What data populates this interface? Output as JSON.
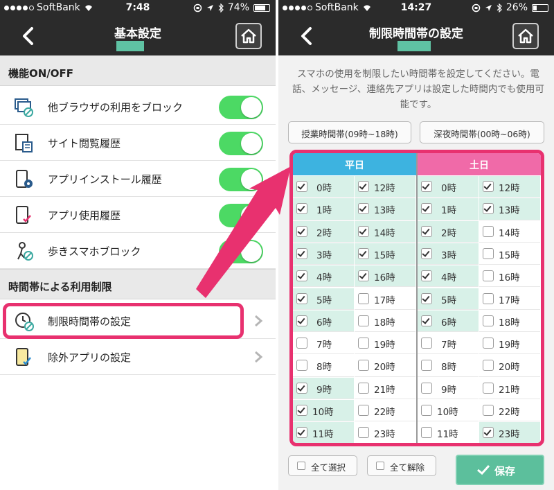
{
  "left": {
    "status": {
      "carrier": "SoftBank",
      "time": "7:48",
      "battery": "74%",
      "battery_level": 0.74
    },
    "nav": {
      "title": "基本設定",
      "back_icon": "chevron-left-icon",
      "home_icon": "home-icon"
    },
    "section1": {
      "title": "機能ON/OFF"
    },
    "rows": [
      {
        "label": "他ブラウザの利用をブロック",
        "icon": "browser-block-icon",
        "on": true
      },
      {
        "label": "サイト閲覧履歴",
        "icon": "site-history-icon",
        "on": true
      },
      {
        "label": "アプリインストール履歴",
        "icon": "app-install-icon",
        "on": true
      },
      {
        "label": "アプリ使用履歴",
        "icon": "app-usage-icon",
        "on": true
      },
      {
        "label": "歩きスマホブロック",
        "icon": "walking-block-icon",
        "on": true
      }
    ],
    "section2": {
      "title": "時間帯による利用制限"
    },
    "links": [
      {
        "label": "制限時間帯の設定",
        "icon": "clock-block-icon"
      },
      {
        "label": "除外アプリの設定",
        "icon": "exclude-app-icon"
      }
    ],
    "colors": {
      "toggle_on": "#4cd964",
      "highlight": "#e8316f",
      "accent_green": "#5fc2a3"
    }
  },
  "right": {
    "status": {
      "carrier": "SoftBank",
      "time": "14:27",
      "battery": "26%",
      "battery_level": 0.26
    },
    "nav": {
      "title": "制限時間帯の設定",
      "back_icon": "chevron-left-icon",
      "home_icon": "home-icon"
    },
    "description": "スマホの使用を制限したい時間帯を設定してください。電話、メッセージ、連絡先アプリは設定した時間内でも使用可能です。",
    "presets": [
      "授業時間帯(09時~18時)",
      "深夜時間帯(00時~06時)"
    ],
    "weekday": {
      "header": "平日",
      "color": "#3db3e0",
      "hours": [
        {
          "label": "0時",
          "checked": true
        },
        {
          "label": "1時",
          "checked": true
        },
        {
          "label": "2時",
          "checked": true
        },
        {
          "label": "3時",
          "checked": true
        },
        {
          "label": "4時",
          "checked": true
        },
        {
          "label": "5時",
          "checked": true
        },
        {
          "label": "6時",
          "checked": true
        },
        {
          "label": "7時",
          "checked": false
        },
        {
          "label": "8時",
          "checked": false
        },
        {
          "label": "9時",
          "checked": true
        },
        {
          "label": "10時",
          "checked": true
        },
        {
          "label": "11時",
          "checked": true
        },
        {
          "label": "12時",
          "checked": true
        },
        {
          "label": "13時",
          "checked": true
        },
        {
          "label": "14時",
          "checked": true
        },
        {
          "label": "15時",
          "checked": true
        },
        {
          "label": "16時",
          "checked": true
        },
        {
          "label": "17時",
          "checked": false
        },
        {
          "label": "18時",
          "checked": false
        },
        {
          "label": "19時",
          "checked": false
        },
        {
          "label": "20時",
          "checked": false
        },
        {
          "label": "21時",
          "checked": false
        },
        {
          "label": "22時",
          "checked": false
        },
        {
          "label": "23時",
          "checked": false
        }
      ]
    },
    "weekend": {
      "header": "土日",
      "color": "#f06aa8",
      "hours": [
        {
          "label": "0時",
          "checked": true
        },
        {
          "label": "1時",
          "checked": true
        },
        {
          "label": "2時",
          "checked": true
        },
        {
          "label": "3時",
          "checked": true
        },
        {
          "label": "4時",
          "checked": true
        },
        {
          "label": "5時",
          "checked": true
        },
        {
          "label": "6時",
          "checked": true
        },
        {
          "label": "7時",
          "checked": false
        },
        {
          "label": "8時",
          "checked": false
        },
        {
          "label": "9時",
          "checked": false
        },
        {
          "label": "10時",
          "checked": false
        },
        {
          "label": "11時",
          "checked": false
        },
        {
          "label": "12時",
          "checked": true
        },
        {
          "label": "13時",
          "checked": true
        },
        {
          "label": "14時",
          "checked": false
        },
        {
          "label": "15時",
          "checked": false
        },
        {
          "label": "16時",
          "checked": false
        },
        {
          "label": "17時",
          "checked": false
        },
        {
          "label": "18時",
          "checked": false
        },
        {
          "label": "19時",
          "checked": false
        },
        {
          "label": "20時",
          "checked": false
        },
        {
          "label": "21時",
          "checked": false
        },
        {
          "label": "22時",
          "checked": false
        },
        {
          "label": "23時",
          "checked": true
        }
      ]
    },
    "select_all": "全て選択",
    "clear_all": "全て解除",
    "save": "保存",
    "save_icon": "checkmark-icon",
    "colors": {
      "checked_bg": "#d8f1e8",
      "save_bg": "#5cbf9c",
      "highlight": "#e8316f"
    }
  }
}
